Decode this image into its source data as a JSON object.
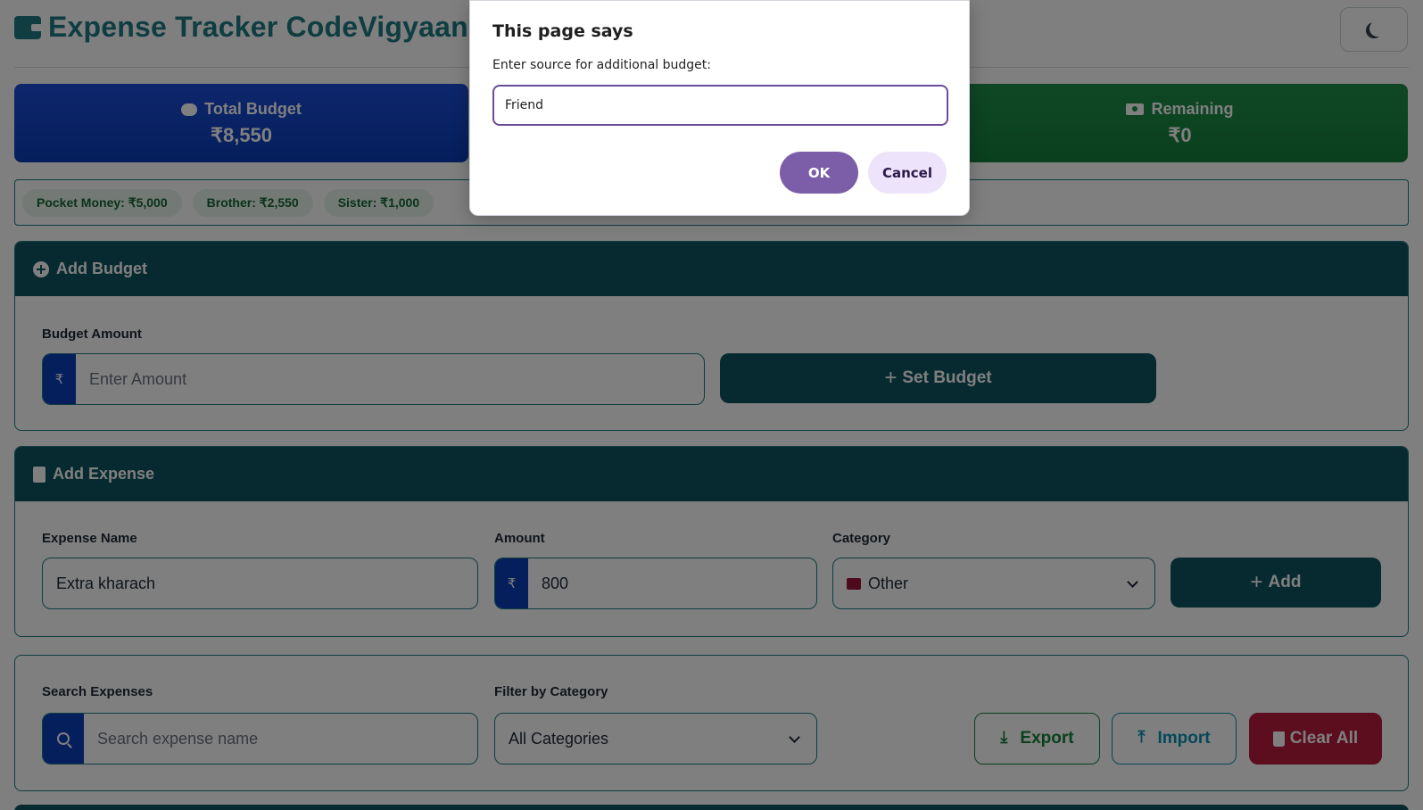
{
  "app": {
    "title": "Expense Tracker CodeVigyaan",
    "theme_icon": "moon-icon"
  },
  "stats": {
    "total_budget_label": "Total Budget",
    "total_budget_value": "₹8,550",
    "remaining_label": "Remaining",
    "remaining_value": "₹0",
    "colors": {
      "budget": "#1d4ed8",
      "spent": "#c2410c",
      "remaining": "#1f8f4a"
    }
  },
  "sources": [
    {
      "label": "Pocket Money: ₹5,000"
    },
    {
      "label": "Brother: ₹2,550"
    },
    {
      "label": "Sister: ₹1,000"
    }
  ],
  "add_budget": {
    "header": "Add Budget",
    "amount_label": "Budget Amount",
    "currency_symbol": "₹",
    "amount_placeholder": "Enter Amount",
    "set_button": "Set Budget"
  },
  "add_expense": {
    "header": "Add Expense",
    "name_label": "Expense Name",
    "name_value": "Extra kharach",
    "amount_label": "Amount",
    "currency_symbol": "₹",
    "amount_value": "800",
    "category_label": "Category",
    "category_value": "Other",
    "add_button": "Add"
  },
  "filters": {
    "search_label": "Search Expenses",
    "search_placeholder": "Search expense name",
    "category_label": "Filter by Category",
    "category_value": "All Categories",
    "export_button": "Export",
    "import_button": "Import",
    "clear_button": "Clear All"
  },
  "dialog": {
    "title": "This page says",
    "message": "Enter source for additional budget:",
    "input_value": "Friend",
    "ok_button": "OK",
    "cancel_button": "Cancel",
    "accent": "#6b4c9a"
  }
}
